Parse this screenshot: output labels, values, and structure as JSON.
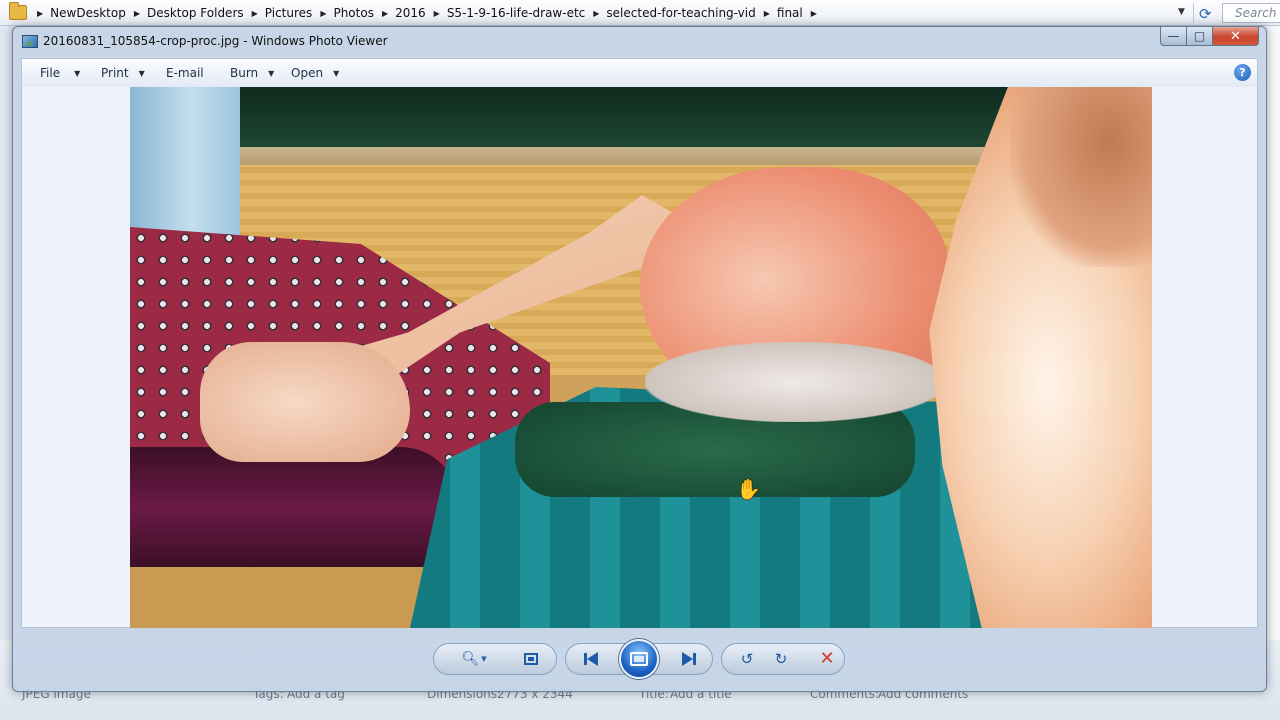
{
  "explorer": {
    "breadcrumb": [
      "NewDesktop",
      "Desktop Folders",
      "Pictures",
      "Photos",
      "2016",
      "S5-1-9-16-life-draw-etc",
      "selected-for-teaching-vid",
      "final"
    ],
    "search_placeholder": "Search",
    "details": {
      "type_label": "JPEG image",
      "tags_label": "Tags:",
      "tags_value": "Add a tag",
      "dimensions_label": "Dimensions:",
      "dimensions_value": "2773 x 2344",
      "title_label": "Title:",
      "title_value": "Add a title",
      "comments_label": "Comments:",
      "comments_value": "Add comments"
    }
  },
  "viewer": {
    "title": "20160831_105854-crop-proc.jpg - Windows Photo Viewer",
    "menu": {
      "file": "File",
      "print": "Print",
      "email": "E-mail",
      "burn": "Burn",
      "open": "Open"
    },
    "help_glyph": "?",
    "caption": {
      "minimize": "—",
      "maximize": "□",
      "close": "✕"
    }
  },
  "icons": {
    "zoom": "zoom-icon",
    "fit": "actual-size-icon",
    "previous": "previous-icon",
    "slideshow": "slideshow-icon",
    "next": "next-icon",
    "rotate_ccw": "rotate-counterclockwise-icon",
    "rotate_cw": "rotate-clockwise-icon",
    "delete": "delete-icon",
    "cursor": "hand-cursor-icon"
  },
  "colors": {
    "accent": "#1f5aa8",
    "delete": "#d43a2a",
    "close_button": "#c7452b"
  }
}
